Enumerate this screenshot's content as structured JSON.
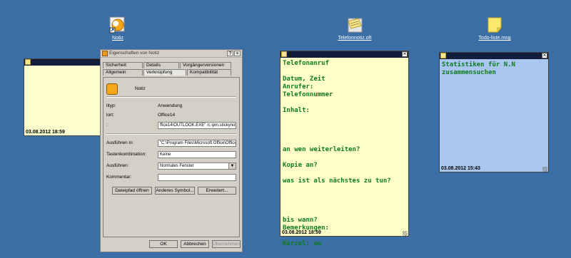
{
  "desktop": {
    "icons": [
      {
        "label": "Notiz",
        "icon": "outlook-shortcut-icon"
      },
      {
        "label": "Telefonnotiz.oft",
        "icon": "sticky-note-template-icon"
      },
      {
        "label": "Todo-liste.msg",
        "icon": "sticky-note-message-icon"
      }
    ]
  },
  "notes": {
    "blank": {
      "date": "03.08.2012 18:59",
      "bg": "#ffffd0"
    },
    "telefon": {
      "bg": "#ffffc8",
      "text_color": "#0e7a1e",
      "lines": [
        "Telefonanruf",
        "",
        "Datum, Zeit",
        "Anrufer:",
        "Telefonnummer",
        "",
        "Inhalt:",
        "",
        "",
        "",
        "",
        "an wen weiterleiten?",
        "",
        "Kopie an?",
        "",
        "was ist als nächstes zu tun?",
        "",
        "",
        "",
        "",
        "bis wann?",
        "Bemerkungen:",
        "",
        "Kürzel: ow"
      ],
      "date": "03.08.2012 18:59"
    },
    "statistik": {
      "bg": "#a9c7ee",
      "text_color": "#0e7a1e",
      "lines": [
        "Statistiken für N.N",
        "zusammensuchen"
      ],
      "date": "03.08.2012 15:43"
    }
  },
  "dialog": {
    "title": "Eigenschaften von Notiz",
    "help": "?",
    "close": "×",
    "tabs_row1": [
      "Sicherheit",
      "Details",
      "Vorgängerversionen"
    ],
    "tabs_row2": [
      "Allgemein",
      "Verknüpfung",
      "Kompatibilität"
    ],
    "name": "Notiz",
    "rows": [
      {
        "key": "lltyp:",
        "value": "Anwendung"
      },
      {
        "key": "lort:",
        "value": "Office14"
      },
      {
        "key": ":",
        "value": "ffice14\\OUTLOOK.EXE\" /c ipm.stickynote"
      }
    ],
    "ausfuehren_in_label": "Ausführen in:",
    "ausfuehren_in_value": "\"C:\\Program Files\\Microsoft Office\\Office14\\",
    "tastenkombination_label": "Tastenkombination:",
    "tastenkombination_value": "Keine",
    "ausfuehren_label": "Ausführen:",
    "ausfuehren_value": "Normales Fenster",
    "kommentar_label": "Kommentar:",
    "kommentar_value": "",
    "buttons": {
      "dateipfad": "Dateipfad öffnen",
      "symbol": "Anderes Symbol...",
      "erweitert": "Erweitert..."
    },
    "footer": {
      "ok": "OK",
      "abbrechen": "Abbrechen",
      "uebernehmen": "Übernehmen"
    }
  }
}
